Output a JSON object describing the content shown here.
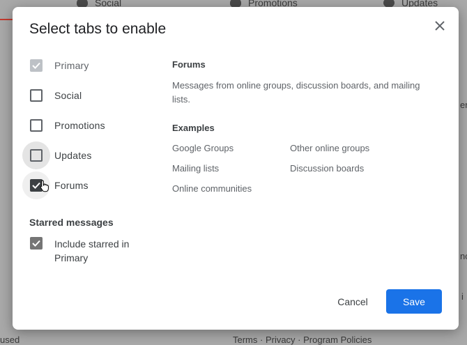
{
  "background": {
    "tabs": [
      {
        "label": "Social",
        "icon": "people-icon"
      },
      {
        "label": "Promotions",
        "icon": "tag-icon"
      },
      {
        "label": "Updates",
        "icon": "info-icon"
      }
    ],
    "left_bottom_text": "used",
    "footer_links": "Terms · Privacy · Program Policies",
    "right_fragments": [
      "er",
      "nc",
      "i"
    ]
  },
  "dialog": {
    "title": "Select tabs to enable",
    "close_icon": "close-icon",
    "options": [
      {
        "label": "Primary",
        "checked": true,
        "disabled": true
      },
      {
        "label": "Social",
        "checked": false
      },
      {
        "label": "Promotions",
        "checked": false
      },
      {
        "label": "Updates",
        "checked": false
      },
      {
        "label": "Forums",
        "checked": true
      }
    ],
    "starred": {
      "section_label": "Starred messages",
      "label": "Include starred in Primary",
      "checked": true
    },
    "panel": {
      "title": "Forums",
      "description": "Messages from online groups, discussion boards, and mailing lists.",
      "examples_title": "Examples",
      "examples": [
        "Google Groups",
        "Other online groups",
        "Mailing lists",
        "Discussion boards",
        "Online communities"
      ]
    },
    "buttons": {
      "cancel": "Cancel",
      "save": "Save"
    },
    "colors": {
      "primary": "#1a73e8",
      "overlay": "#a9a9a9"
    }
  }
}
